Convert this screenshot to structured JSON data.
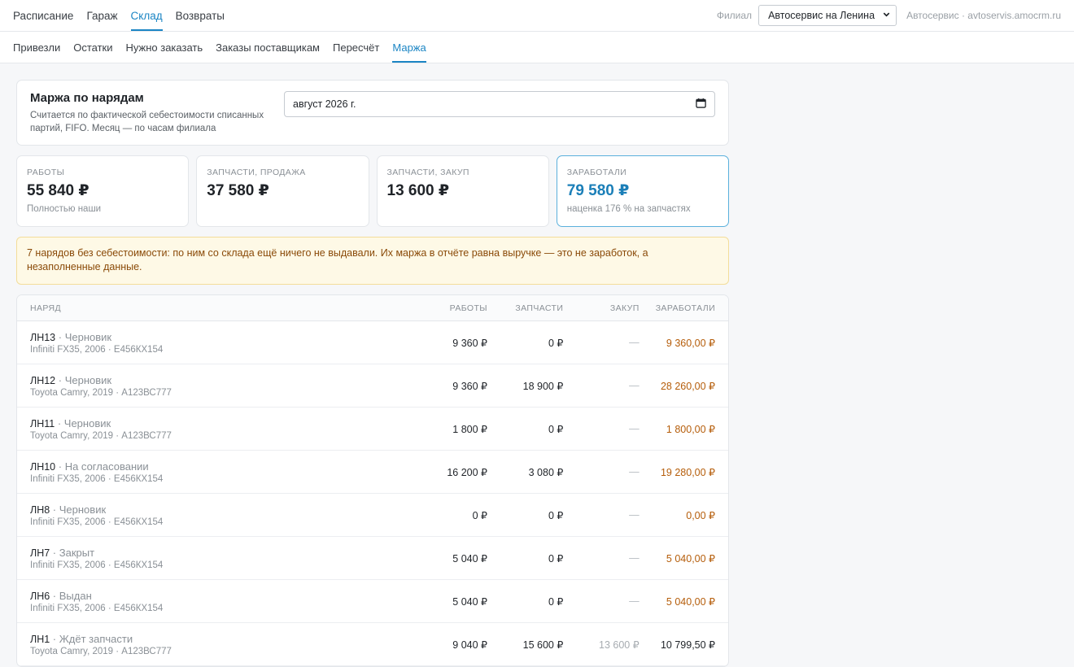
{
  "top_nav": {
    "tabs": [
      {
        "label": "Расписание",
        "active": false
      },
      {
        "label": "Гараж",
        "active": false
      },
      {
        "label": "Склад",
        "active": true
      },
      {
        "label": "Возвраты",
        "active": false
      }
    ],
    "branch_label": "Филиал",
    "branch_value": "Автосервис на Ленина",
    "account": "Автосервис · avtoservis.amocrm.ru"
  },
  "sub_nav": {
    "tabs": [
      {
        "label": "Привезли",
        "active": false
      },
      {
        "label": "Остатки",
        "active": false
      },
      {
        "label": "Нужно заказать",
        "active": false
      },
      {
        "label": "Заказы поставщикам",
        "active": false
      },
      {
        "label": "Пересчёт",
        "active": false
      },
      {
        "label": "Маржа",
        "active": true
      }
    ]
  },
  "header": {
    "title": "Маржа по нарядам",
    "subtitle": "Считается по фактической себестоимости списанных партий, FIFO. Месяц — по часам филиала",
    "month_value": "август 2026 г."
  },
  "kpis": [
    {
      "label": "Работы",
      "value": "55 840 ₽",
      "note": "Полностью наши",
      "highlight": false
    },
    {
      "label": "Запчасти, продажа",
      "value": "37 580 ₽",
      "note": "",
      "highlight": false
    },
    {
      "label": "Запчасти, закуп",
      "value": "13 600 ₽",
      "note": "",
      "highlight": false
    },
    {
      "label": "Заработали",
      "value": "79 580 ₽",
      "note": "наценка 176 % на запчастях",
      "highlight": true
    }
  ],
  "warning": "7 нарядов без себестоимости: по ним со склада ещё ничего не выдавали. Их маржа в отчёте равна выручке — это не заработок, а незаполненные данные.",
  "table": {
    "headers": {
      "order": "Наряд",
      "works": "Работы",
      "parts": "Запчасти",
      "purchase": "Закуп",
      "earned": "Заработали"
    },
    "rows": [
      {
        "id": "ЛН13",
        "status": "Черновик",
        "car": "Infiniti FX35, 2006 · Е456КХ154",
        "works": "9 360 ₽",
        "parts": "0 ₽",
        "purchase": "—",
        "earned": "9 360,00 ₽",
        "no_cost": true
      },
      {
        "id": "ЛН12",
        "status": "Черновик",
        "car": "Toyota Camry, 2019 · А123ВС777",
        "works": "9 360 ₽",
        "parts": "18 900 ₽",
        "purchase": "—",
        "earned": "28 260,00 ₽",
        "no_cost": true
      },
      {
        "id": "ЛН11",
        "status": "Черновик",
        "car": "Toyota Camry, 2019 · А123ВС777",
        "works": "1 800 ₽",
        "parts": "0 ₽",
        "purchase": "—",
        "earned": "1 800,00 ₽",
        "no_cost": true
      },
      {
        "id": "ЛН10",
        "status": "На согласовании",
        "car": "Infiniti FX35, 2006 · Е456КХ154",
        "works": "16 200 ₽",
        "parts": "3 080 ₽",
        "purchase": "—",
        "earned": "19 280,00 ₽",
        "no_cost": true
      },
      {
        "id": "ЛН8",
        "status": "Черновик",
        "car": "Infiniti FX35, 2006 · Е456КХ154",
        "works": "0 ₽",
        "parts": "0 ₽",
        "purchase": "—",
        "earned": "0,00 ₽",
        "no_cost": true
      },
      {
        "id": "ЛН7",
        "status": "Закрыт",
        "car": "Infiniti FX35, 2006 · Е456КХ154",
        "works": "5 040 ₽",
        "parts": "0 ₽",
        "purchase": "—",
        "earned": "5 040,00 ₽",
        "no_cost": true
      },
      {
        "id": "ЛН6",
        "status": "Выдан",
        "car": "Infiniti FX35, 2006 · Е456КХ154",
        "works": "5 040 ₽",
        "parts": "0 ₽",
        "purchase": "—",
        "earned": "5 040,00 ₽",
        "no_cost": true
      },
      {
        "id": "ЛН1",
        "status": "Ждёт запчасти",
        "car": "Toyota Camry, 2019 · А123ВС777",
        "works": "9 040 ₽",
        "parts": "15 600 ₽",
        "purchase": "13 600 ₽",
        "earned": "10 799,50 ₽",
        "no_cost": false
      }
    ]
  },
  "colors": {
    "accent": "#1b85c4",
    "warning_text": "#8a4a08",
    "earned_no_cost": "#b55d0a"
  }
}
